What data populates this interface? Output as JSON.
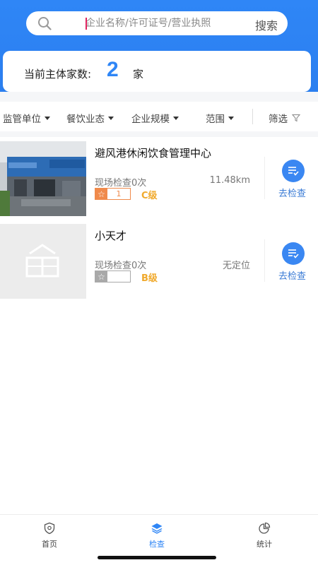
{
  "search": {
    "placeholder": "企业名称/许可证号/营业执照",
    "button_label": "搜索"
  },
  "summary": {
    "label": "当前主体家数:",
    "count": "2",
    "unit": "家"
  },
  "filters": [
    {
      "label": "监管单位"
    },
    {
      "label": "餐饮业态"
    },
    {
      "label": "企业规模"
    },
    {
      "label": "范围"
    },
    {
      "label": "筛选"
    }
  ],
  "list": [
    {
      "name": "避风港休闲饮食管理中心",
      "inspection_text": "现场检查0次",
      "distance": "11.48km",
      "star_count": "1",
      "grade": "C级",
      "action_label": "去检查",
      "badge_color": "#f08a4b"
    },
    {
      "name": "小天才",
      "inspection_text": "现场检查0次",
      "distance": "无定位",
      "star_count": "",
      "grade": "B级",
      "action_label": "去检查",
      "badge_color": "#a9a9a9"
    }
  ],
  "tabs": [
    {
      "label": "首页",
      "icon": "shield-icon"
    },
    {
      "label": "检查",
      "icon": "layers-icon"
    },
    {
      "label": "统计",
      "icon": "pie-chart-icon"
    }
  ],
  "colors": {
    "primary": "#2f86f6",
    "grade": "#f0a92b"
  }
}
